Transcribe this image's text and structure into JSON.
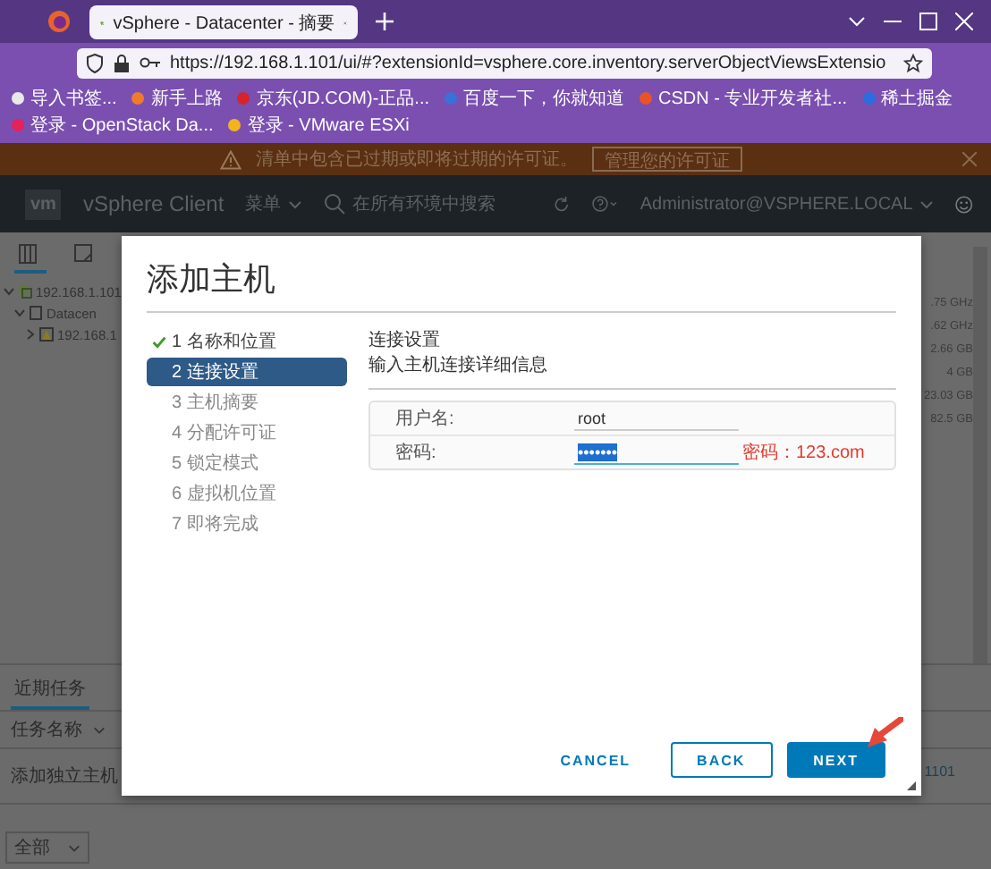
{
  "browser": {
    "tab": {
      "title": "vSphere - Datacenter - 摘要"
    },
    "url": "https://192.168.1.101/ui/#?extensionId=vsphere.core.inventory.serverObjectViewsExtensio",
    "bookmarks": [
      "导入书签...",
      "新手上路",
      "京东(JD.COM)-正品...",
      "百度一下，你就知道",
      "CSDN - 专业开发者社...",
      "稀土掘金",
      "登录 - OpenStack Da...",
      "登录 - VMware ESXi"
    ]
  },
  "warning": {
    "text": "清单中包含已过期或即将过期的许可证。",
    "button": "管理您的许可证"
  },
  "header": {
    "logo": "vm",
    "brand": "vSphere Client",
    "menu": "菜单",
    "search_placeholder": "在所有环境中搜索",
    "user": "Administrator@VSPHERE.LOCAL"
  },
  "tree": [
    {
      "label": "192.168.1.101",
      "expanded": true,
      "children": [
        {
          "label": "Datacen",
          "expanded": true,
          "children": [
            {
              "label": "192.168.1",
              "expanded": false
            }
          ]
        }
      ]
    }
  ],
  "side_values": [
    ".75 GHz",
    ".62 GHz",
    "2.66 GB",
    "4 GB",
    "23.03 GB",
    "82.5 GB"
  ],
  "modal": {
    "title": "添加主机",
    "steps": [
      {
        "label": "1 名称和位置",
        "done": true,
        "selected": false
      },
      {
        "label": "2 连接设置",
        "done": false,
        "selected": true
      },
      {
        "label": "3 主机摘要",
        "done": false,
        "selected": false
      },
      {
        "label": "4 分配许可证",
        "done": false,
        "selected": false
      },
      {
        "label": "5 锁定模式",
        "done": false,
        "selected": false
      },
      {
        "label": "6 虚拟机位置",
        "done": false,
        "selected": false
      },
      {
        "label": "7 即将完成",
        "done": false,
        "selected": false
      }
    ],
    "section_title": "连接设置",
    "section_subtitle": "输入主机连接详细信息",
    "fields": [
      {
        "label": "用户名:",
        "value": "root",
        "highlighted": false
      },
      {
        "label": "密码:",
        "value": "•••••••",
        "highlighted": true
      }
    ],
    "annotation": "密码：123.com",
    "buttons": [
      {
        "label": "CANCEL",
        "kind": "flat"
      },
      {
        "label": "BACK",
        "kind": "outline"
      },
      {
        "label": "NEXT",
        "kind": "primary"
      }
    ]
  },
  "tasks": {
    "tabs": [
      {
        "label": "近期任务",
        "selected": true
      }
    ],
    "column": "任务名称",
    "rows": [
      "添加独立主机"
    ],
    "fragment": "1101",
    "filter": "全部"
  }
}
